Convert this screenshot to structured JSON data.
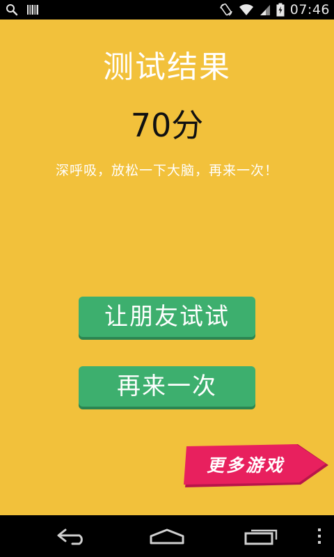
{
  "status_bar": {
    "time": "07:46",
    "icons": [
      "search-icon",
      "barcode-icon",
      "rotate-icon",
      "wifi-icon",
      "signal-icon",
      "battery-icon"
    ]
  },
  "result": {
    "title": "测试结果",
    "score": "70分",
    "message": "深呼吸，放松一下大脑，再来一次！"
  },
  "buttons": {
    "share_label": "让朋友试试",
    "retry_label": "再来一次",
    "more_games_label": "更多游戏"
  },
  "nav_bar": {
    "icons": [
      "back-icon",
      "home-icon",
      "recent-apps-icon",
      "menu-icon"
    ]
  },
  "colors": {
    "background": "#f2c13b",
    "button_green": "#3daf6e",
    "more_games_pink": "#e8205e",
    "title_text": "#ffffff",
    "score_text": "#111111"
  }
}
